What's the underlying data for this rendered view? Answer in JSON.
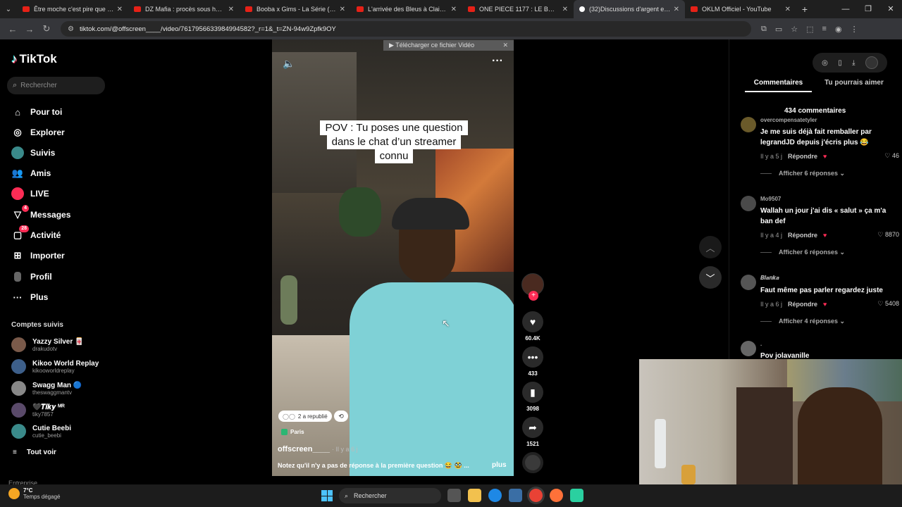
{
  "browser": {
    "tabs": [
      {
        "label": "Être moche c'est pire que de m",
        "icon": "youtube-icon"
      },
      {
        "label": "DZ Mafia : procès sous haute te",
        "icon": "youtube-icon"
      },
      {
        "label": "Booba x Gims - La Série (Audio",
        "icon": "youtube-icon"
      },
      {
        "label": "L'arrivée des Bleus à Clairefonta",
        "icon": "youtube-icon"
      },
      {
        "label": "ONE PIECE 1177 : LE BORDEL",
        "icon": "youtube-icon"
      },
      {
        "label": "(32)Discussions d'argent et inte",
        "icon": "tiktok-icon",
        "active": true
      },
      {
        "label": "OKLM Officiel - YouTube",
        "icon": "youtube-icon"
      }
    ],
    "url": "tiktok.com/@offscreen____/video/7617956633984994582?_r=1&_t=ZN-94w9Zpfk9OY"
  },
  "sidebar": {
    "logo": "TikTok",
    "search_placeholder": "Rechercher",
    "nav": [
      {
        "label": "Pour toi",
        "icon": "home-icon"
      },
      {
        "label": "Explorer",
        "icon": "compass-icon"
      },
      {
        "label": "Suivis",
        "icon": "following-icon"
      },
      {
        "label": "Amis",
        "icon": "friends-icon"
      },
      {
        "label": "LIVE",
        "icon": "live-icon"
      },
      {
        "label": "Messages",
        "icon": "messages-icon",
        "badge": "4"
      },
      {
        "label": "Activité",
        "icon": "activity-icon",
        "badge": "28"
      },
      {
        "label": "Importer",
        "icon": "upload-icon"
      },
      {
        "label": "Profil",
        "icon": "profile-icon"
      },
      {
        "label": "Plus",
        "icon": "more-icon"
      }
    ],
    "followed_title": "Comptes suivis",
    "followed": [
      {
        "name": "Yazzy Silver 🀄",
        "handle": "drakudotv",
        "color": "#7a5a4a"
      },
      {
        "name": "Kikoo World Replay",
        "handle": "kikooworldreplay",
        "color": "#3d5f8a"
      },
      {
        "name": "Swagg Man 🔵",
        "handle": "theswaggmantv",
        "color": "#888888"
      },
      {
        "name": "🖤𝑻𝒊𝒌𝒚 ᴹᴿ",
        "handle": "tiky7857",
        "color": "#5a4a6a"
      },
      {
        "name": "Cutie Beebi",
        "handle": "cutie_beebi",
        "color": "#3a8a8a"
      }
    ],
    "see_all": "Tout voir",
    "footer_label": "Entreprise"
  },
  "video": {
    "download_banner": "▶ Télécharger ce fichier Vidéo",
    "caption": "POV : Tu poses une question dans le chat d’un streamer connu",
    "repost_label": "2 a republié",
    "location": "Paris",
    "author": "offscreen____",
    "time": "· Il y a 6 j",
    "description": "Notez qu'il n'y a pas de réponse à la première question 😂 🥸 ...",
    "more_label": "plus"
  },
  "actions": {
    "likes": "60.4K",
    "comments": "433",
    "saves": "3098",
    "shares": "1521"
  },
  "panel": {
    "tabs": [
      "Commentaires",
      "Tu pourrais aimer"
    ],
    "comment_count": "434 commentaires",
    "comments": [
      {
        "user": "overcompensatetyler",
        "text": "Je me suis déjà fait remballer par legrandJD depuis j'écris plus 😂",
        "time": "Il y a 5 j",
        "reply": "Répondre",
        "likes": "♡ 46",
        "replies": "Afficher 6 réponses ⌄"
      },
      {
        "user": "Mo9507",
        "text": "Wallah un jour j'ai dis « salut » ça m'a ban def",
        "time": "Il y a 4 j",
        "reply": "Répondre",
        "likes": "♡ 8870",
        "replies": "Afficher 6 réponses ⌄"
      },
      {
        "user": "𝑩𝒍𝒂𝒏𝒌𝒂",
        "text": "Faut même pas parler regardez juste",
        "time": "Il y a 6 j",
        "reply": "Répondre",
        "likes": "♡ 5408",
        "replies": "Afficher 4 réponses ⌄"
      },
      {
        "user": ".",
        "text": "Pov jolavanille",
        "time": "",
        "reply": "",
        "likes": "",
        "replies": ""
      }
    ]
  },
  "taskbar": {
    "temp": "7°C",
    "weather": "Temps dégagé",
    "search": "Rechercher"
  }
}
